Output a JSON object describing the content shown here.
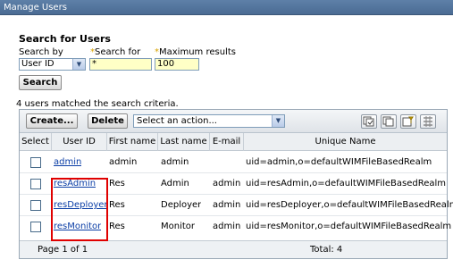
{
  "window": {
    "title": "Manage Users"
  },
  "search": {
    "heading": "Search for Users",
    "search_by_label": "Search by",
    "search_by_value": "User ID",
    "search_for_label": "Search for",
    "search_for_value": "*",
    "max_results_label": "Maximum results",
    "max_results_value": "100",
    "search_button": "Search",
    "required_marker": "*"
  },
  "results": {
    "matched_text": "4 users matched the search criteria."
  },
  "toolbar": {
    "create_label": "Create...",
    "delete_label": "Delete",
    "action_placeholder": "Select an action...",
    "icons": [
      "select-all-icon",
      "deselect-all-icon",
      "edit-filter-icon",
      "column-settings-icon"
    ]
  },
  "table": {
    "columns": [
      "Select",
      "User ID",
      "First name",
      "Last name",
      "E-mail",
      "Unique Name"
    ],
    "rows": [
      {
        "user_id": "admin",
        "first_name": "admin",
        "last_name": "admin",
        "email": "",
        "unique_name": "uid=admin,o=defaultWIMFileBasedRealm"
      },
      {
        "user_id": "resAdmin",
        "first_name": "Res",
        "last_name": "Admin",
        "email": "admin",
        "unique_name": "uid=resAdmin,o=defaultWIMFileBasedRealm"
      },
      {
        "user_id": "resDeployer",
        "first_name": "Res",
        "last_name": "Deployer",
        "email": "admin",
        "unique_name": "uid=resDeployer,o=defaultWIMFileBasedRealm"
      },
      {
        "user_id": "resMonitor",
        "first_name": "Res",
        "last_name": "Monitor",
        "email": "admin",
        "unique_name": "uid=resMonitor,o=defaultWIMFileBasedRealm"
      }
    ],
    "page_label": "Page 1 of 1",
    "total_label": "Total: 4"
  },
  "colors": {
    "titlebar": "#4a6b93",
    "link": "#0b3ea6",
    "highlight": "#e00000",
    "required": "#d9a300"
  }
}
